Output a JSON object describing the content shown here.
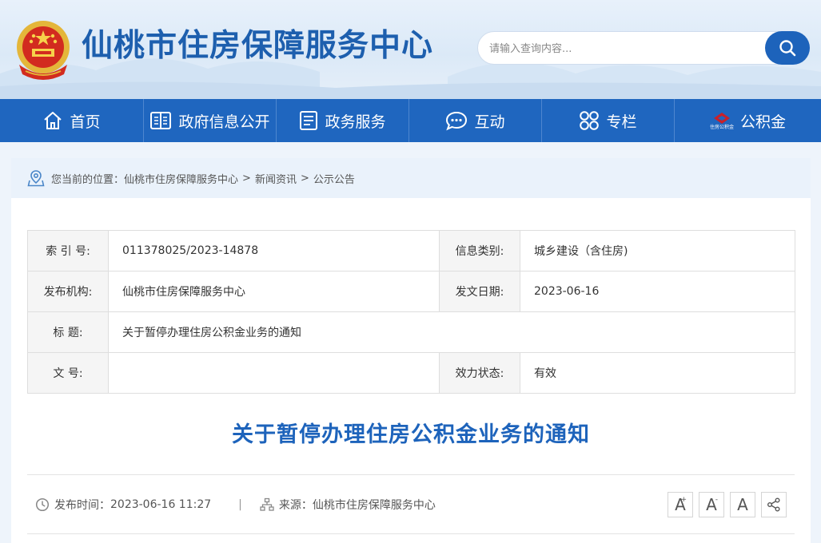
{
  "header": {
    "site_title": "仙桃市住房保障服务中心",
    "search_placeholder": "请输入查询内容...",
    "emblem_icon": "national-emblem-icon",
    "search_icon": "search-icon"
  },
  "nav": {
    "items": [
      {
        "label": "首页",
        "icon": "home-icon"
      },
      {
        "label": "政府信息公开",
        "icon": "book-icon"
      },
      {
        "label": "政务服务",
        "icon": "document-icon"
      },
      {
        "label": "互动",
        "icon": "chat-icon"
      },
      {
        "label": "专栏",
        "icon": "grid-icon"
      },
      {
        "label": "公积金",
        "icon": "housing-fund-logo-icon",
        "logo_text": "住房公积金"
      }
    ]
  },
  "breadcrumb": {
    "prefix": "您当前的位置：",
    "items": [
      "仙桃市住房保障服务中心",
      "新闻资讯",
      "公示公告"
    ],
    "separator": ">"
  },
  "info": {
    "index_label": "索 引 号:",
    "index_value": "011378025/2023-14878",
    "category_label": "信息类别:",
    "category_value": "城乡建设（含住房)",
    "org_label": "发布机构:",
    "org_value": "仙桃市住房保障服务中心",
    "date_label": "发文日期:",
    "date_value": "2023-06-16",
    "title_label": "标 题:",
    "title_value": "关于暂停办理住房公积金业务的通知",
    "docno_label": "文 号:",
    "docno_value": "",
    "status_label": "效力状态:",
    "status_value": "有效"
  },
  "article": {
    "title": "关于暂停办理住房公积金业务的通知",
    "publish_label": "发布时间：",
    "publish_time": "2023-06-16 11:27",
    "divider": "|",
    "source_label": "来源：",
    "source_value": "仙桃市住房保障服务中心"
  },
  "tools": {
    "font_increase": "A",
    "font_increase_mark": "+",
    "font_decrease": "A",
    "font_decrease_mark": "-",
    "font_reset": "A",
    "share_icon": "share-icon"
  },
  "colors": {
    "brand_blue": "#1d63bb",
    "nav_blue": "#1f66bf",
    "title_blue": "#1d5fae"
  }
}
